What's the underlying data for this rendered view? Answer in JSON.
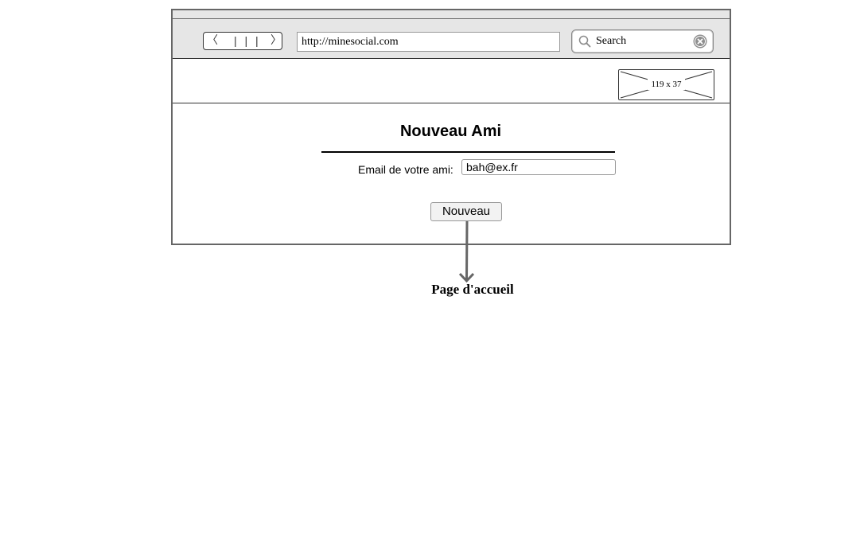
{
  "browser": {
    "nav_buttons": {
      "back_glyph": "〈",
      "separators": "| | |",
      "forward_glyph": "〉"
    },
    "url": "http://minesocial.com",
    "search": {
      "label": "Search",
      "icon": "search-icon",
      "clear_icon": "clear-icon"
    }
  },
  "header": {
    "image_placeholder_label": "119 x 37"
  },
  "form": {
    "title": "Nouveau Ami",
    "email_label": "Email de votre ami:",
    "email_value": "bah@ex.fr",
    "submit_label": "Nouveau"
  },
  "link": {
    "target_label": "Page d'accueil",
    "arrow_color": "#666666"
  },
  "colors": {
    "frame_border": "#666666",
    "toolbar_bg": "#e6e6e6"
  }
}
